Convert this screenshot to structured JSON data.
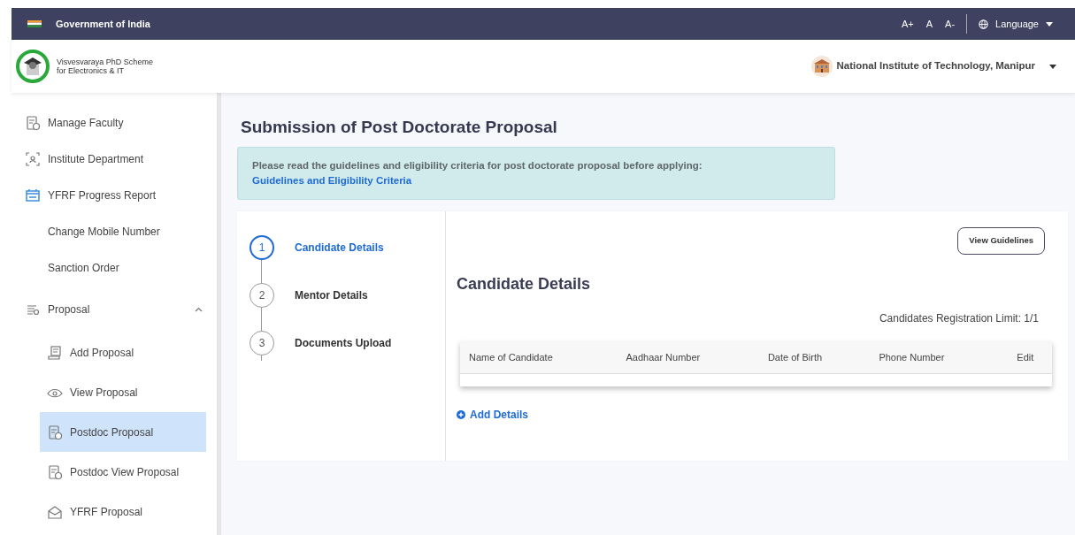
{
  "topbar": {
    "title": "Government of India",
    "font_controls": [
      "A+",
      "A",
      "A-"
    ],
    "language": "Language"
  },
  "header": {
    "brand_lines": [
      "Visvesvaraya PhD Scheme",
      "for Electronics & IT"
    ],
    "institute": "National Institute of Technology, Manipur"
  },
  "sidebar": {
    "items": [
      {
        "label": "Manage Faculty",
        "kind": "doc",
        "selected": false
      },
      {
        "label": "Institute Department",
        "kind": "people",
        "selected": false
      },
      {
        "label": "YFRF Progress Report",
        "kind": "report",
        "selected": false
      },
      {
        "label": "Change Mobile Number",
        "kind": "none",
        "selected": false
      },
      {
        "label": "Sanction Order",
        "kind": "none",
        "selected": false
      },
      {
        "label": "Proposal",
        "kind": "list",
        "selected": false,
        "expanded": true,
        "children": [
          {
            "label": "Add Proposal",
            "kind": "add",
            "selected": false
          },
          {
            "label": "View Proposal",
            "kind": "eye",
            "selected": false
          },
          {
            "label": "Postdoc Proposal",
            "kind": "doc",
            "selected": true
          },
          {
            "label": "Postdoc View Proposal",
            "kind": "doc",
            "selected": false
          },
          {
            "label": "YFRF Proposal",
            "kind": "mail",
            "selected": false
          }
        ]
      }
    ]
  },
  "page": {
    "title": "Submission of Post Doctorate Proposal",
    "alert": {
      "text": "Please read the guidelines and eligibility criteria for post doctorate proposal before applying:",
      "link": "Guidelines and Eligibility Criteria"
    },
    "steps": [
      {
        "number": "1",
        "label": "Candidate Details",
        "selected": true
      },
      {
        "number": "2",
        "label": "Mentor Details",
        "selected": false
      },
      {
        "number": "3",
        "label": "Documents Upload",
        "selected": false
      }
    ],
    "guidelines_button": "View Guidelines",
    "section_title": "Candidate Details",
    "limit": "Candidates Registration Limit: 1/1",
    "table": {
      "columns": [
        "Name of Candidate",
        "Aadhaar Number",
        "Date of Birth",
        "Phone Number",
        "Edit"
      ]
    },
    "add_link": "Add Details"
  }
}
